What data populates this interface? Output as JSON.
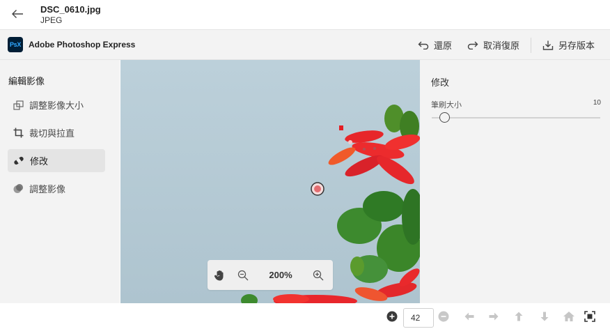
{
  "file": {
    "name": "DSC_0610.jpg",
    "type": "JPEG"
  },
  "app": {
    "logo_text": "PsX",
    "name": "Adobe Photoshop Express"
  },
  "toolbar": {
    "undo": "還原",
    "redo": "取消復原",
    "save_version": "另存版本"
  },
  "sidebar": {
    "title": "編輯影像",
    "items": [
      {
        "label": "調整影像大小",
        "icon": "resize-icon",
        "active": false
      },
      {
        "label": "裁切與拉直",
        "icon": "crop-icon",
        "active": false
      },
      {
        "label": "修改",
        "icon": "bandage-icon",
        "active": true
      },
      {
        "label": "調整影像",
        "icon": "adjust-icon",
        "active": false
      }
    ]
  },
  "panel": {
    "title": "修改",
    "brush_label": "筆刷大小",
    "brush_value": "10"
  },
  "zoom": {
    "value": "200%"
  },
  "footer": {
    "page_value": "42"
  },
  "colors": {
    "sea": "#b7cbd6",
    "petal": "#e42a2c",
    "leaf": "#3f8a2c",
    "panel_bg": "#f3f3f3"
  }
}
